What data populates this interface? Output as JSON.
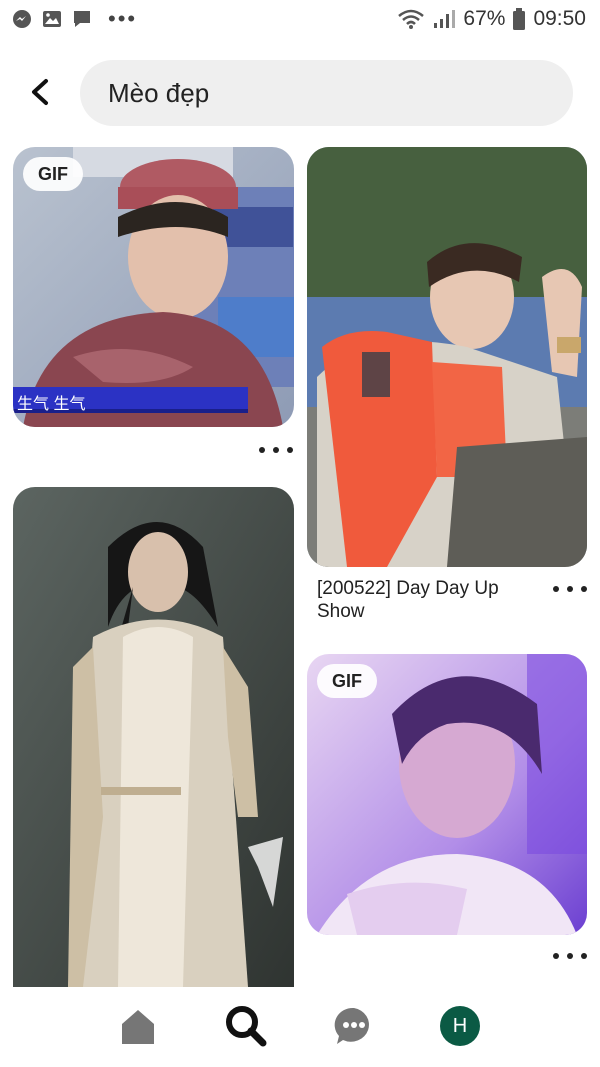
{
  "status_bar": {
    "left_icons": [
      "messenger-icon",
      "gallery-icon",
      "chat-icon"
    ],
    "more": "•••",
    "battery": "67%",
    "time": "09:50"
  },
  "search": {
    "query": "Mèo đẹp"
  },
  "pins": [
    {
      "badge": "GIF",
      "caption_strip": "生气 生气",
      "title": ""
    },
    {
      "badge": "",
      "title": "[200522] Day Day Up Show"
    },
    {
      "badge": "",
      "title": ""
    },
    {
      "badge": "GIF",
      "title": ""
    }
  ],
  "bottom_nav": {
    "items": [
      "home-icon",
      "search-icon",
      "messages-icon",
      "profile-avatar"
    ],
    "avatar_letter": "H"
  },
  "colors": {
    "search_bg": "#efefef",
    "avatar_bg": "#0b5a44",
    "nav_icon": "#767676",
    "active_icon": "#111111"
  }
}
